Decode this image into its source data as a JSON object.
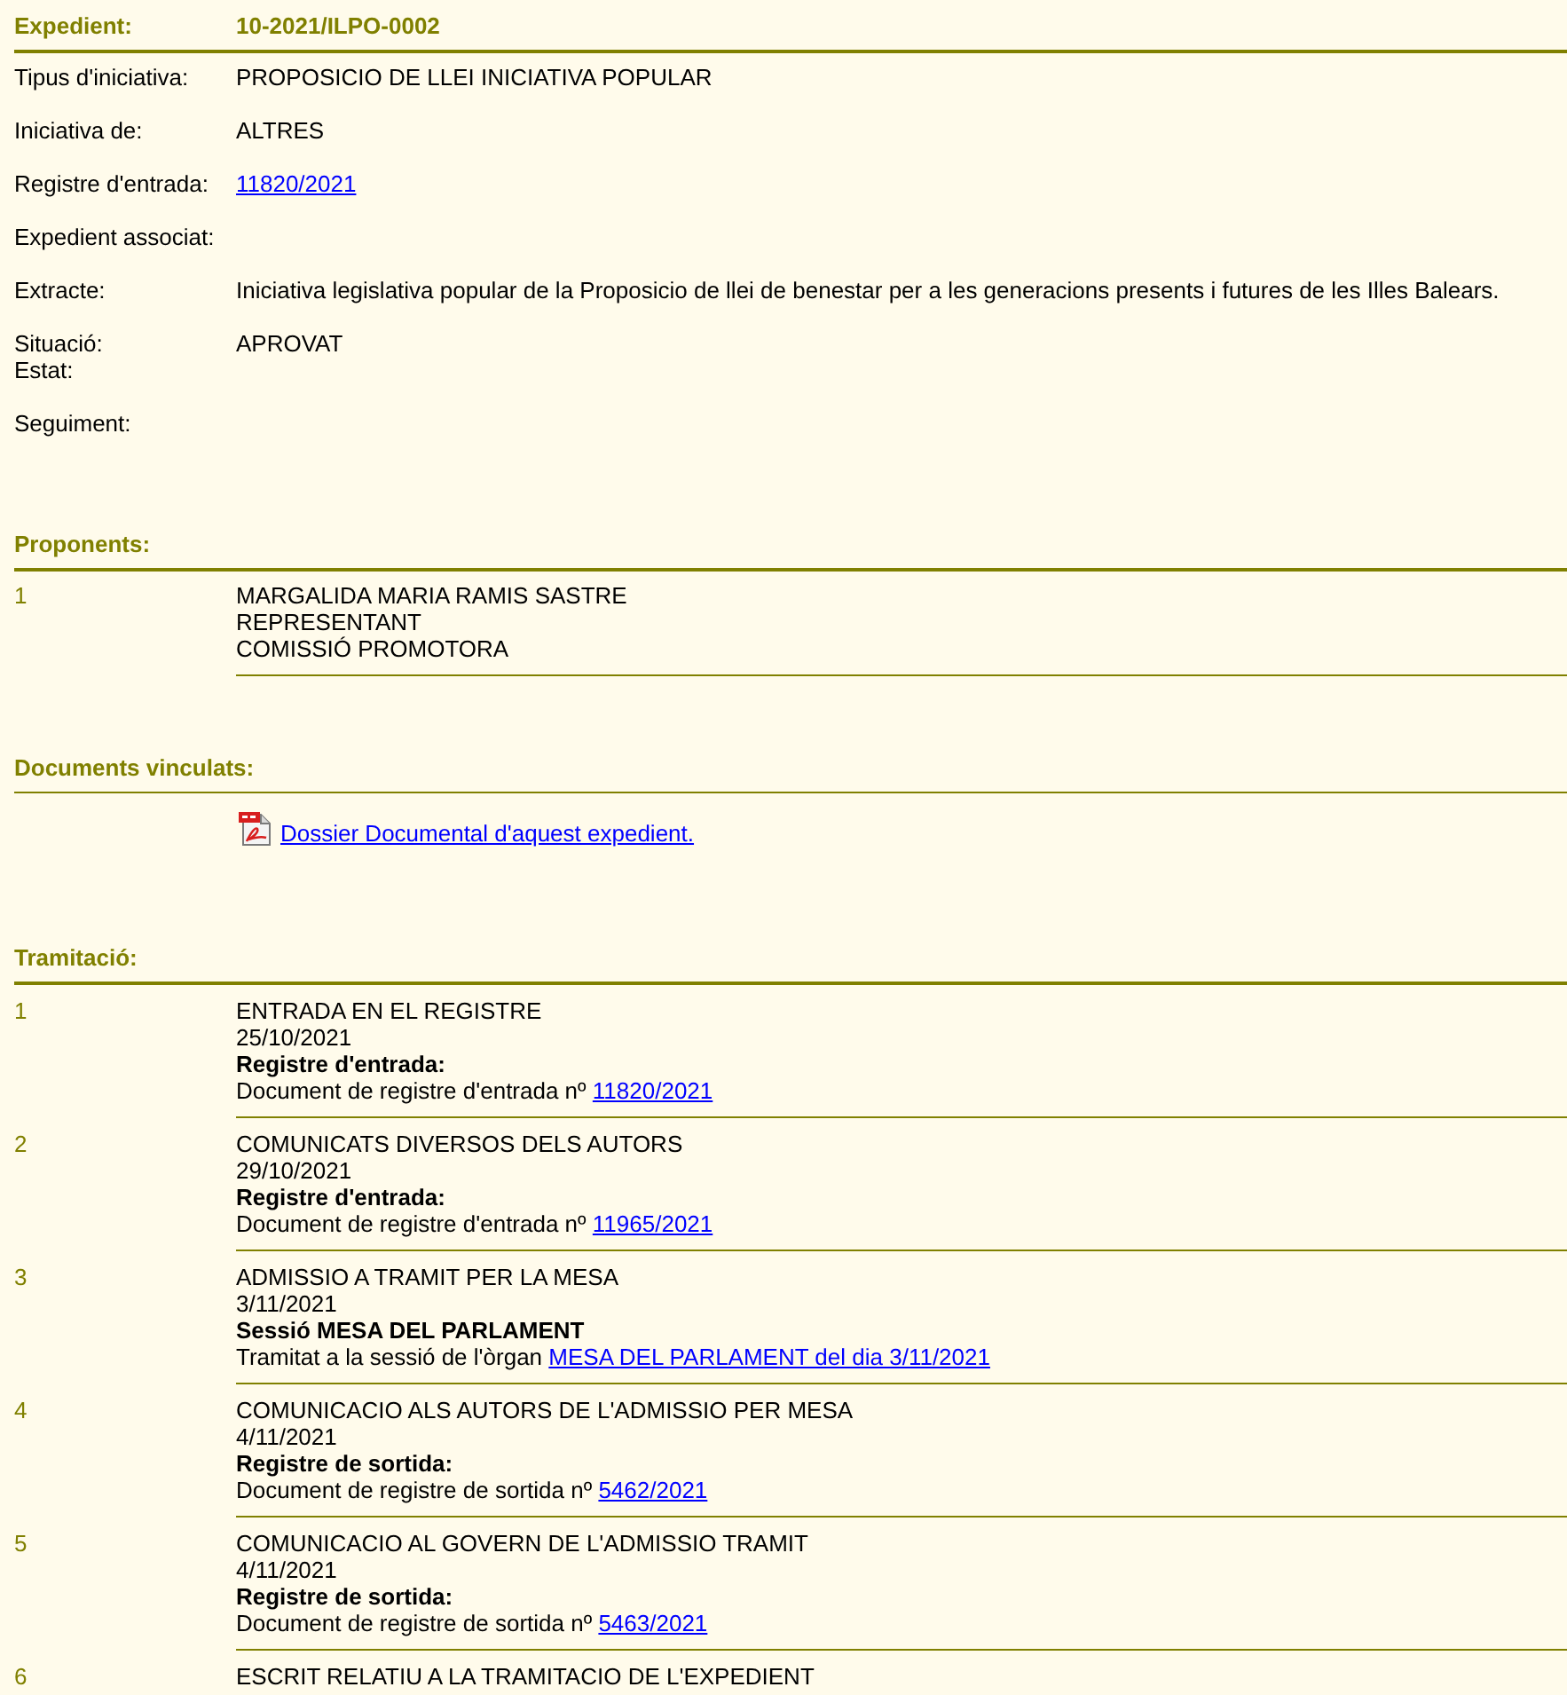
{
  "expedient": {
    "label": "Expedient:",
    "value": "10-2021/ILPO-0002"
  },
  "fields": [
    {
      "label": "Tipus d'iniciativa:",
      "kind": "text",
      "value": "PROPOSICIO DE LLEI INICIATIVA POPULAR"
    },
    {
      "label": "Iniciativa de:",
      "kind": "text",
      "value": "ALTRES"
    },
    {
      "label": "Registre d'entrada:",
      "kind": "link",
      "value": "11820/2021"
    },
    {
      "label": "Expedient associat:"
    },
    {
      "label": "Extracte:",
      "kind": "text",
      "value": "Iniciativa legislativa popular de la Proposicio de llei de benestar per a les generacions presents i futures de les Illes Balears."
    },
    {
      "label": "Situació:",
      "second_label": "Estat:",
      "kind": "text",
      "value": "APROVAT"
    },
    {
      "label": "Seguiment:"
    }
  ],
  "proponents": {
    "title": "Proponents:",
    "items": [
      {
        "number": "1",
        "lines": [
          "MARGALIDA MARIA RAMIS SASTRE",
          "REPRESENTANT",
          "COMISSIÓ PROMOTORA"
        ]
      }
    ]
  },
  "documents": {
    "title": "Documents vinculats:",
    "items": [
      {
        "link": "Dossier Documental d'aquest expedient."
      }
    ]
  },
  "tramitacio": {
    "title": "Tramitació:",
    "items": [
      {
        "number": "1",
        "title": "ENTRADA EN EL REGISTRE",
        "date": "25/10/2021",
        "subtitle": "Registre d'entrada:",
        "text": "Document de registre d'entrada nº",
        "link": "11820/2021"
      },
      {
        "number": "2",
        "title": "COMUNICATS DIVERSOS DELS AUTORS",
        "date": "29/10/2021",
        "subtitle": "Registre d'entrada:",
        "text": "Document de registre d'entrada nº",
        "link": "11965/2021"
      },
      {
        "number": "3",
        "title": "ADMISSIO A TRAMIT PER LA MESA",
        "date": "3/11/2021",
        "subtitle": "Sessió MESA DEL PARLAMENT",
        "text": "Tramitat a la sessió de l'òrgan",
        "link": "MESA DEL PARLAMENT del dia 3/11/2021"
      },
      {
        "number": "4",
        "title": "COMUNICACIO ALS AUTORS DE L'ADMISSIO PER MESA",
        "date": "4/11/2021",
        "subtitle": "Registre de sortida:",
        "text": "Document de registre de sortida nº",
        "link": "5462/2021"
      },
      {
        "number": "5",
        "title": "COMUNICACIO AL GOVERN DE L'ADMISSIO TRAMIT",
        "date": "4/11/2021",
        "subtitle": "Registre de sortida:",
        "text": "Document de registre de sortida nº",
        "link": "5463/2021"
      },
      {
        "number": "6",
        "title": "ESCRIT RELATIU A LA TRAMITACIO DE L'EXPEDIENT"
      }
    ]
  }
}
